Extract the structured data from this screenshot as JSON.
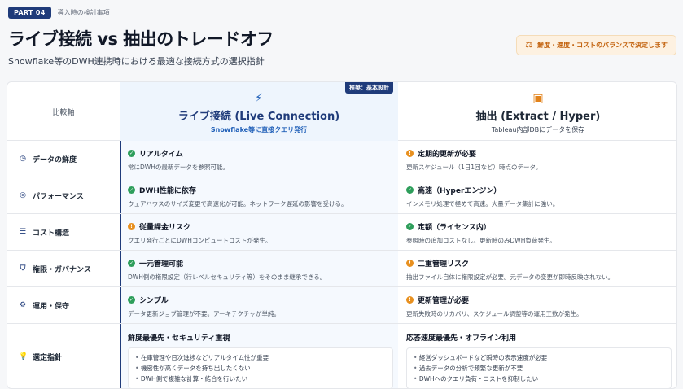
{
  "header": {
    "part_badge": "PART 04",
    "part_sub": "導入時の検討事項",
    "title": "ライブ接続 vs 抽出のトレードオフ",
    "subtitle": "Snowflake等のDWH連携時における最適な接続方式の選択指針",
    "balance_label": "鮮度・速度・コストのバランスで決定します",
    "balance_icon": "scale-icon"
  },
  "table": {
    "axis_header": "比較軸",
    "live": {
      "badge": "推奨：基本設計",
      "icon": "bolt-icon",
      "title": "ライブ接続 (Live Connection)",
      "sub": "Snowflake等に直接クエリ発行"
    },
    "extract": {
      "icon": "box-icon",
      "title": "抽出 (Extract / Hyper)",
      "sub": "Tableau内部DBにデータを保存"
    },
    "rows": [
      {
        "axis": "データの鮮度",
        "axis_icon": "clock-icon",
        "live_status": "ok",
        "live_title": "リアルタイム",
        "live_desc": "常にDWHの最新データを参照可能。",
        "ext_status": "warn",
        "ext_title": "定期的更新が必要",
        "ext_desc": "更新スケジュール（1日1回など）時点のデータ。"
      },
      {
        "axis": "パフォーマンス",
        "axis_icon": "gauge-icon",
        "live_status": "ok",
        "live_title": "DWH性能に依存",
        "live_desc": "ウェアハウスのサイズ変更で高速化が可能。ネットワーク遅延の影響を受ける。",
        "ext_status": "ok",
        "ext_title": "高速（Hyperエンジン）",
        "ext_desc": "インメモリ処理で極めて高速。大量データ集計に強い。"
      },
      {
        "axis": "コスト構造",
        "axis_icon": "coins-icon",
        "live_status": "warn",
        "live_title": "従量課金リスク",
        "live_desc": "クエリ発行ごとにDWHコンピュートコストが発生。",
        "ext_status": "ok",
        "ext_title": "定額（ライセンス内）",
        "ext_desc": "参照時の追加コストなし。更新時のみDWH負荷発生。"
      },
      {
        "axis": "権限・ガバナンス",
        "axis_icon": "shield-icon",
        "live_status": "ok",
        "live_title": "一元管理可能",
        "live_desc": "DWH側の権限設定（行レベルセキュリティ等）をそのまま継承できる。",
        "ext_status": "warn",
        "ext_title": "二重管理リスク",
        "ext_desc": "抽出ファイル自体に権限設定が必要。元データの変更が即時反映されない。"
      },
      {
        "axis": "運用・保守",
        "axis_icon": "gears-icon",
        "live_status": "ok",
        "live_title": "シンプル",
        "live_desc": "データ更新ジョブ管理が不要。アーキテクチャが単純。",
        "ext_status": "warn",
        "ext_title": "更新管理が必要",
        "ext_desc": "更新失敗時のリカバリ、スケジュール調整等の運用工数が発生。"
      }
    ],
    "guide": {
      "axis": "選定指針",
      "axis_icon": "lightbulb-icon",
      "live_title": "鮮度最優先・セキュリティ重視",
      "live_items": [
        "在庫管理や日次進捗などリアルタイム性が重要",
        "機密性が高くデータを持ち出したくない",
        "DWH側で複雑な計算・結合を行いたい"
      ],
      "ext_title": "応答速度最優先・オフライン利用",
      "ext_items": [
        "経営ダッシュボードなど瞬時の表示速度が必要",
        "過去データの分析で頻繁な更新が不要",
        "DWHへのクエリ負荷・コストを抑制したい"
      ]
    }
  },
  "colors": {
    "navy": "#1f3b7a",
    "ok": "#2e9e5b",
    "warn": "#e8901f",
    "live_bg": "#eef5fd"
  }
}
